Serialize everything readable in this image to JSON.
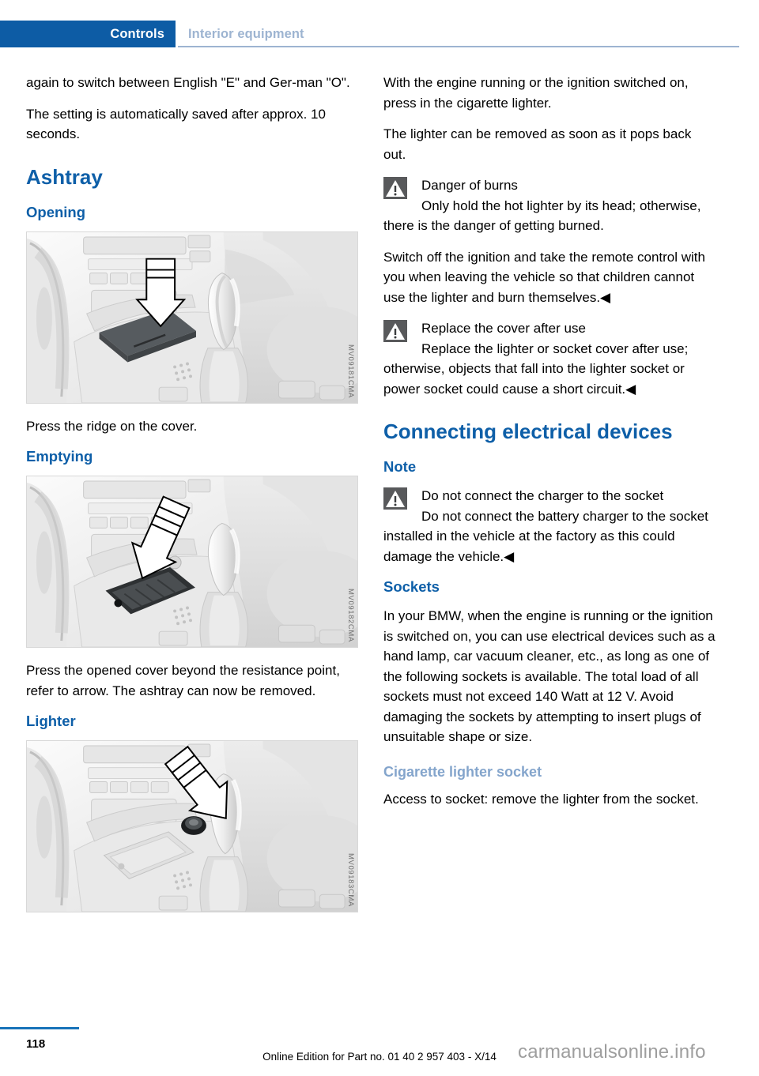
{
  "header": {
    "tab_label": "Controls",
    "section_label": "Interior equipment"
  },
  "left_column": {
    "para_1": "again to switch between English \"E\" and Ger-man \"O\".",
    "para_2": "The setting is automatically saved after approx. 10 seconds.",
    "heading_ashtray": "Ashtray",
    "heading_opening": "Opening",
    "figure_opening_code": "MV09181CMA",
    "caption_opening": "Press the ridge on the cover.",
    "heading_emptying": "Emptying",
    "figure_emptying_code": "MV09182CMA",
    "caption_emptying": "Press the opened cover beyond the resistance point, refer to arrow. The ashtray can now be removed.",
    "heading_lighter": "Lighter",
    "figure_lighter_code": "MV09183CMA"
  },
  "right_column": {
    "para_1": "With the engine running or the ignition switched on, press in the cigarette lighter.",
    "para_2": "The lighter can be removed as soon as it pops back out.",
    "warning_1": {
      "title": "Danger of burns",
      "body": "Only hold the hot lighter by its head; otherwise, there is the danger of getting burned."
    },
    "para_3": "Switch off the ignition and take the remote control with you when leaving the vehicle so that children cannot use the lighter and burn themselves.◀",
    "warning_2": {
      "title": "Replace the cover after use",
      "body": "Replace the lighter or socket cover after use; otherwise, objects that fall into the lighter socket or power socket could cause a short circuit.◀"
    },
    "heading_connecting": "Connecting electrical devices",
    "heading_note": "Note",
    "warning_3": {
      "title": "Do not connect the charger to the socket",
      "body": "Do not connect the battery charger to the socket installed in the vehicle at the factory as this could damage the vehicle.◀"
    },
    "heading_sockets": "Sockets",
    "para_sockets": "In your BMW, when the engine is running or the ignition is switched on, you can use electrical devices such as a hand lamp, car vacuum cleaner, etc., as long as one of the following sockets is available. The total load of all sockets must not exceed 140 Watt at 12 V. Avoid damaging the sockets by attempting to insert plugs of unsuitable shape or size.",
    "heading_cig_socket": "Cigarette lighter socket",
    "para_cig_socket": "Access to socket: remove the lighter from the socket."
  },
  "footer": {
    "page_number": "118",
    "edition_text": "Online Edition for Part no. 01 40 2 957 403 - X/14",
    "watermark": "carmanualsonline.info"
  },
  "colors": {
    "header_blue": "#0d5ca5",
    "heading_blue": "#0e5fa8",
    "subheading_light_blue": "#84a5cc",
    "rule_blue": "#1873b9",
    "warn_icon_gray": "#58595b"
  }
}
